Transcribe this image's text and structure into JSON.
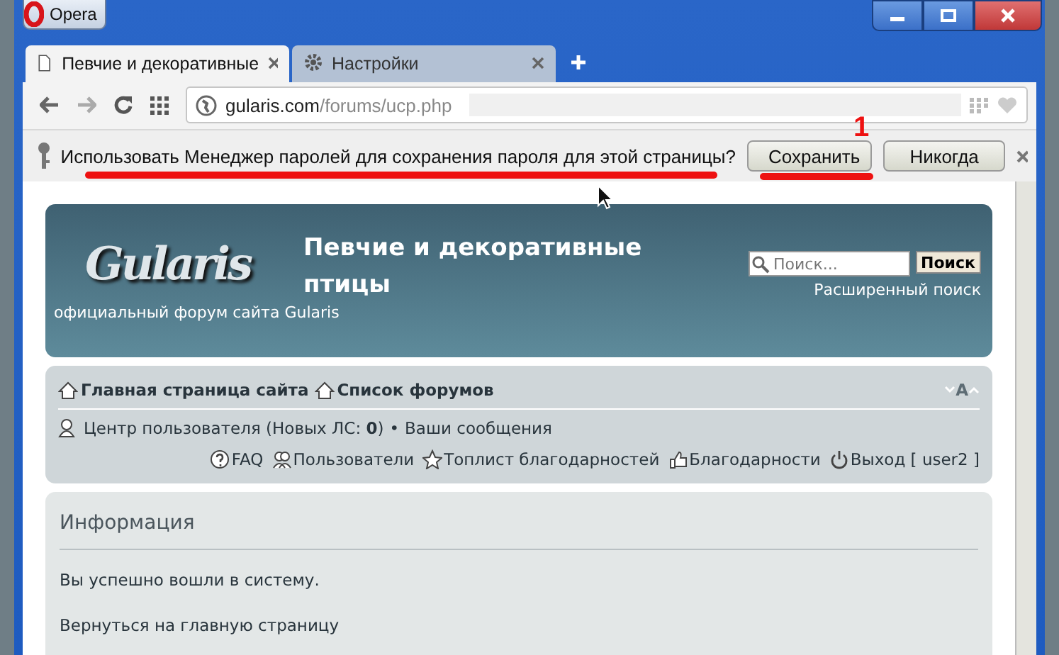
{
  "window": {
    "title": "Opera"
  },
  "tabs": [
    {
      "label": "Певчие и декоративные",
      "kind": "page",
      "selected": true
    },
    {
      "label": "Настройки",
      "kind": "settings",
      "selected": false
    }
  ],
  "address_bar": {
    "domain": "gularis.com",
    "path": "/forums/ucp.php"
  },
  "password_bar": {
    "message": "Использовать Менеджер паролей для сохранения пароля для этой страницы?",
    "buttons": [
      "Сохранить",
      "Никогда"
    ]
  },
  "annotation": {
    "number": "1"
  },
  "forum_header": {
    "logo": "Gularis",
    "tagline": "официальный форум сайта Gularis",
    "title": "Певчие и декоративные птицы",
    "search": {
      "placeholder": "Поиск...",
      "button": "Поиск",
      "advanced": "Расширенный поиск"
    }
  },
  "navbar": {
    "breadcrumbs": [
      "Главная страница сайта",
      "Список форумов"
    ],
    "font_size": "A",
    "user_links": [
      "Центр пользователя (Новых ЛС: **0**)",
      "Ваши сообщения"
    ],
    "separator": "•",
    "links": [
      {
        "label": "FAQ",
        "kind": "faq"
      },
      {
        "label": "Пользователи",
        "kind": "users"
      },
      {
        "label": "Топлист благодарностей",
        "kind": "star"
      },
      {
        "label": "Благодарности",
        "kind": "thumb"
      },
      {
        "label": "Выход [ user2 ]",
        "kind": "power"
      }
    ]
  },
  "info": {
    "title": "Информация",
    "message": "Вы успешно вошли в систему.",
    "link": "Вернуться на главную страницу"
  }
}
